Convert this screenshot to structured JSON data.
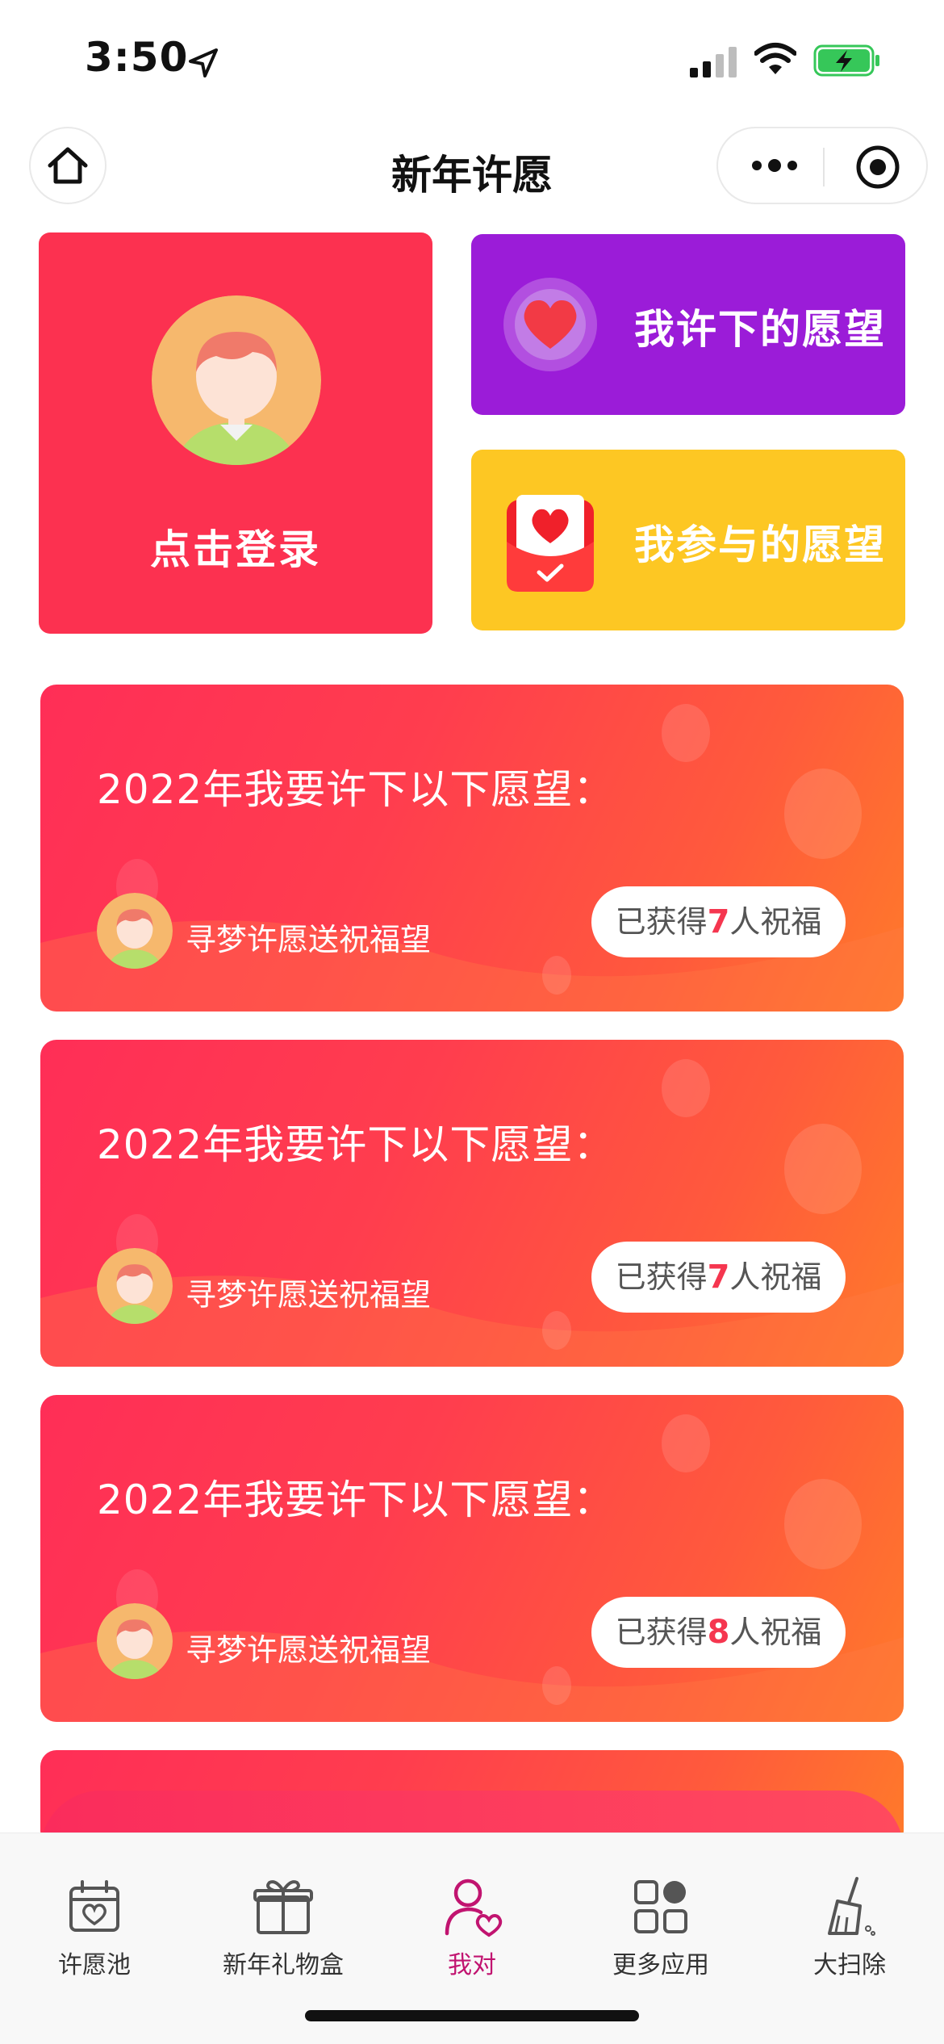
{
  "status_bar": {
    "time": "3:50"
  },
  "nav": {
    "title": "新年许愿"
  },
  "login_card": {
    "label": "点击登录"
  },
  "wish_cards": [
    {
      "label": "我许下的愿望",
      "color": "#9b1cd8",
      "icon": "heart-icon"
    },
    {
      "label": "我参与的愿望",
      "color": "#fdc723",
      "icon": "heart-envelope-icon"
    }
  ],
  "wishes": [
    {
      "title": "2022年我要许下以下愿望：",
      "author": "寻梦许愿送祝福望",
      "prefix": "已获得",
      "count": "7",
      "suffix": "人祝福"
    },
    {
      "title": "2022年我要许下以下愿望：",
      "author": "寻梦许愿送祝福望",
      "prefix": "已获得",
      "count": "7",
      "suffix": "人祝福"
    },
    {
      "title": "2022年我要许下以下愿望：",
      "author": "寻梦许愿送祝福望",
      "prefix": "已获得",
      "count": "8",
      "suffix": "人祝福"
    }
  ],
  "create_button": {
    "label": ""
  },
  "tabs": [
    {
      "label": "许愿池",
      "icon": "calendar-heart-icon"
    },
    {
      "label": "新年礼物盒",
      "icon": "gift-icon"
    },
    {
      "label": "我对",
      "icon": "user-heart-icon",
      "active": true
    },
    {
      "label": "更多应用",
      "icon": "apps-icon"
    },
    {
      "label": "大扫除",
      "icon": "broom-icon"
    }
  ],
  "colors": {
    "login_card": "#fc3150",
    "accent": "#f5364f",
    "tab_active": "#c11470"
  }
}
